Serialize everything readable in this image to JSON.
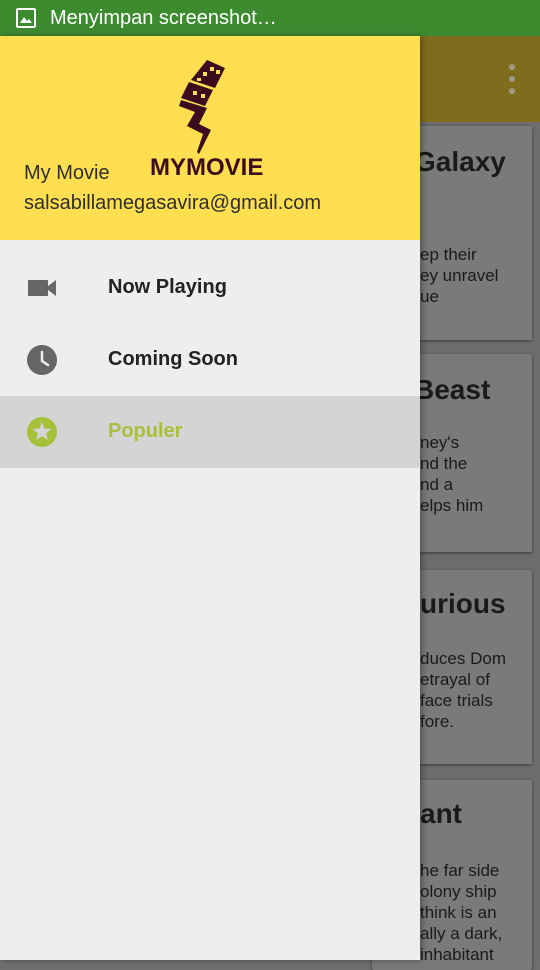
{
  "status_bar": {
    "text": "Menyimpan screenshot…",
    "icon": "image-icon",
    "color": "#3d8b2f"
  },
  "drawer": {
    "logo_text": "MYMOVIE",
    "user_name": "My Movie",
    "user_email": "salsabillamegasavira@gmail.com",
    "header_color": "#ffdf50",
    "accent_color": "#a7c03a",
    "items": [
      {
        "label": "Now Playing",
        "icon": "videocam-icon",
        "active": false
      },
      {
        "label": "Coming Soon",
        "icon": "clock-icon",
        "active": false
      },
      {
        "label": "Populer",
        "icon": "star-icon",
        "active": true
      }
    ]
  },
  "background_list": {
    "cards": [
      {
        "title": "Galaxy",
        "desc": "ep their\ney unravel\nue"
      },
      {
        "title": "Beast",
        "desc": "ney's\nnd the\nnd a\nelps him"
      },
      {
        "title": "urious",
        "desc": "duces Dom\netrayal of\nface trials\nfore."
      },
      {
        "title": "ant",
        "desc": "he far side\nolony ship\nthink is an\nally a dark,\ninhabitant"
      }
    ]
  }
}
